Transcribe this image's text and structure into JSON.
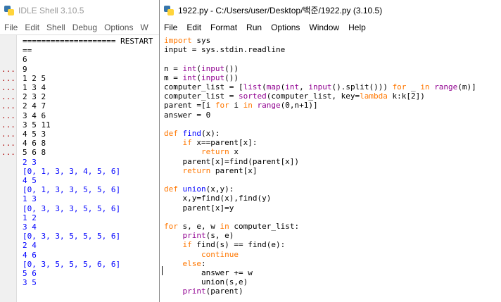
{
  "shell": {
    "title": "IDLE Shell 3.10.5",
    "menu": [
      "File",
      "Edit",
      "Shell",
      "Debug",
      "Options",
      "W"
    ],
    "gutter": "\n\n\n...\n...\n...\n...\n...\n...\n...\n...\n...\n...\n\n\n\n\n\n\n\n\n\n\n\n\n\n\n\n\n\n\n>>>\n>>>",
    "output": "==================== RESTART\n==\n6\n9\n1 2 5\n1 3 4\n2 3 2\n2 4 7\n3 4 6\n3 5 11\n4 5 3\n4 6 8\n5 6 8",
    "output_blue": "2 3\n[0, 1, 3, 3, 4, 5, 6]\n4 5\n[0, 1, 3, 3, 5, 5, 6]\n1 3\n[0, 3, 3, 3, 5, 5, 6]\n1 2\n3 4\n[0, 3, 3, 5, 5, 5, 6]\n2 4\n4 6\n[0, 3, 5, 5, 5, 6, 6]\n5 6\n3 5"
  },
  "editor": {
    "title": "1922.py - C:/Users/user/Desktop/백준/1922.py (3.10.5)",
    "menu": [
      "File",
      "Edit",
      "Format",
      "Run",
      "Options",
      "Window",
      "Help"
    ]
  }
}
